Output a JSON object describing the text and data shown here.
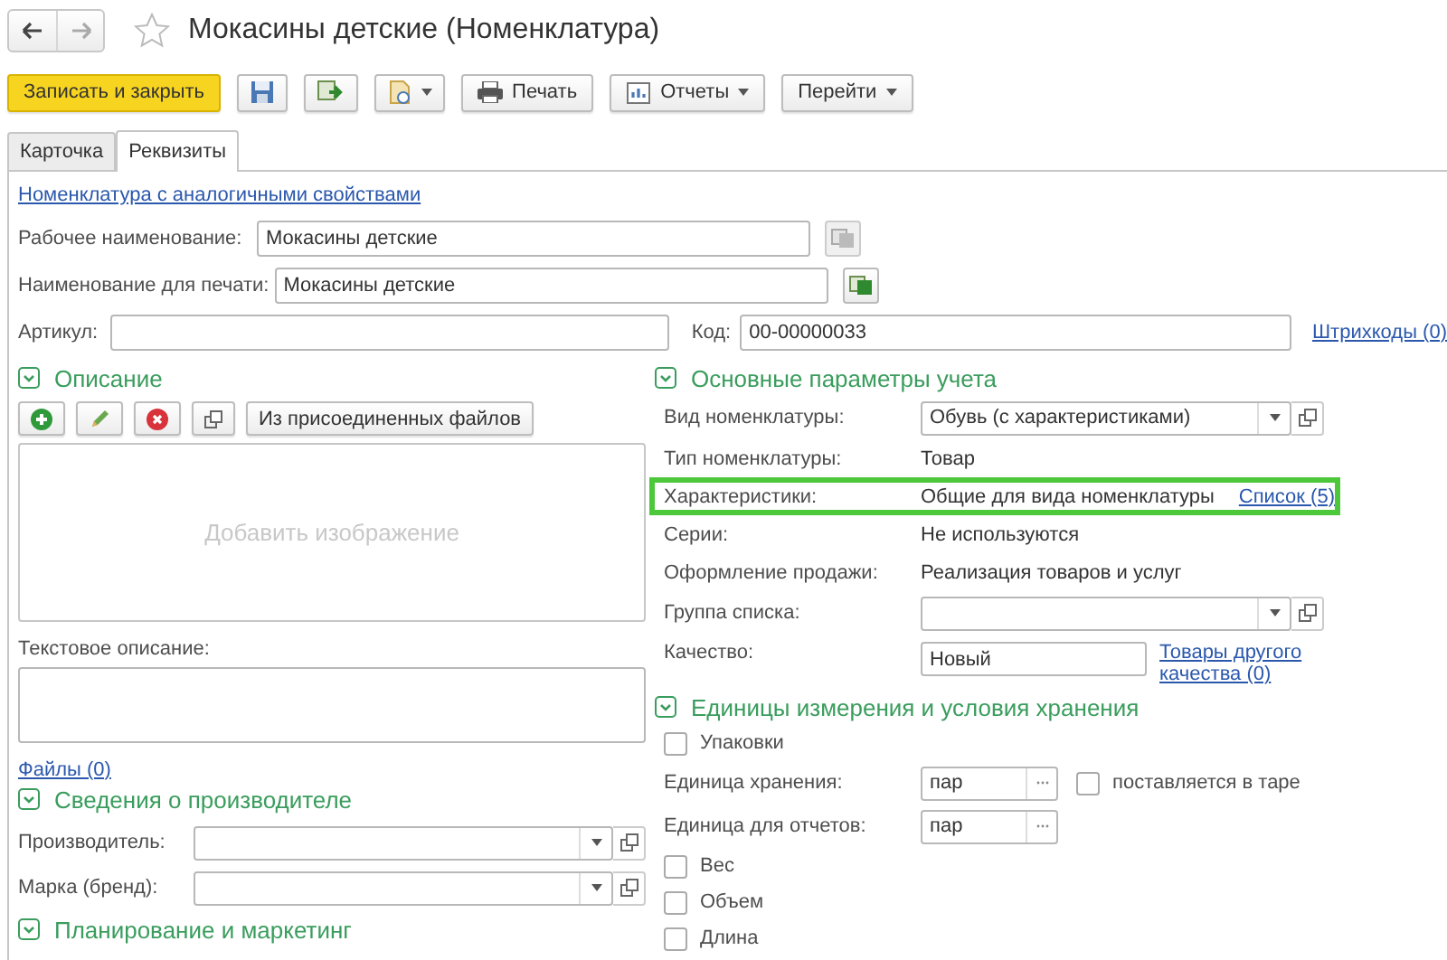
{
  "title": "Мокасины детские (Номенклатура)",
  "starred": false,
  "toolbar": [
    {
      "kind": "primary",
      "label": "Записать и закрыть"
    },
    {
      "kind": "save"
    },
    {
      "kind": "post"
    },
    {
      "kind": "file-menu"
    },
    {
      "kind": "print",
      "label": "Печать"
    },
    {
      "kind": "reports",
      "label": "Отчеты"
    },
    {
      "kind": "menu",
      "label": "Перейти"
    }
  ],
  "tabs": [
    {
      "label": "Карточка",
      "selected": false
    },
    {
      "label": "Реквизиты",
      "selected": true
    }
  ],
  "similar_link": "Номенклатура с аналогичными свойствами",
  "names": [
    {
      "label": "Рабочее наименование:",
      "value": "Мокасины детские",
      "button_enabled": false
    },
    {
      "label": "Наименование для печати:",
      "value": "Мокасины детские",
      "button_enabled": true
    }
  ],
  "article": {
    "label": "Артикул:"
  },
  "code": {
    "label": "Код:",
    "value": "00-00000033"
  },
  "barcodes_link": "Штрихкоды (0)",
  "description": {
    "title": "Описание",
    "expanded": true,
    "buttons": [
      {
        "kind": "add"
      },
      {
        "kind": "edit"
      },
      {
        "kind": "delete"
      },
      {
        "kind": "open"
      },
      {
        "kind": "text",
        "label": "Из присоединенных файлов"
      }
    ],
    "image_placeholder": "Добавить изображение",
    "text_label": "Текстовое описание:",
    "files_link": "Файлы (0)"
  },
  "manufacturer": {
    "title": "Сведения о производителе",
    "expanded": true,
    "fields": [
      {
        "label": "Производитель:"
      },
      {
        "label": "Марка (бренд):"
      }
    ]
  },
  "planning": {
    "title": "Планирование и маркетинг",
    "expanded": true
  },
  "accounting": {
    "title": "Основные параметры учета",
    "expanded": true,
    "rows": [
      {
        "kind": "select",
        "label": "Вид номенклатуры:",
        "value": "Обувь (с характеристиками)"
      },
      {
        "kind": "text",
        "label": "Тип номенклатуры:",
        "value": "Товар"
      },
      {
        "kind": "text",
        "label": "Характеристики:",
        "value": "Общие для вида номенклатуры",
        "link": "Список (5)",
        "highlighted": true
      },
      {
        "kind": "text",
        "label": "Серии:",
        "value": "Не используются"
      },
      {
        "kind": "text",
        "label": "Оформление продажи:",
        "value": "Реализация товаров и услуг"
      },
      {
        "kind": "select",
        "label": "Группа списка:"
      },
      {
        "kind": "input",
        "label": "Качество:",
        "value": "Новый",
        "link": "Товары другого качества (0)"
      }
    ]
  },
  "units": {
    "title": "Единицы измерения и условия хранения",
    "expanded": true,
    "items": [
      {
        "kind": "checkbox",
        "label": "Упаковки",
        "checked": false
      },
      {
        "kind": "unit",
        "label": "Единица хранения:",
        "value": "пар",
        "option": {
          "label": "поставляется в таре",
          "checked": false
        }
      },
      {
        "kind": "unit",
        "label": "Единица для отчетов:",
        "value": "пар"
      },
      {
        "kind": "checkbox",
        "label": "Вес",
        "checked": false
      },
      {
        "kind": "checkbox",
        "label": "Объем",
        "checked": false
      },
      {
        "kind": "checkbox",
        "label": "Длина",
        "checked": false
      }
    ]
  }
}
